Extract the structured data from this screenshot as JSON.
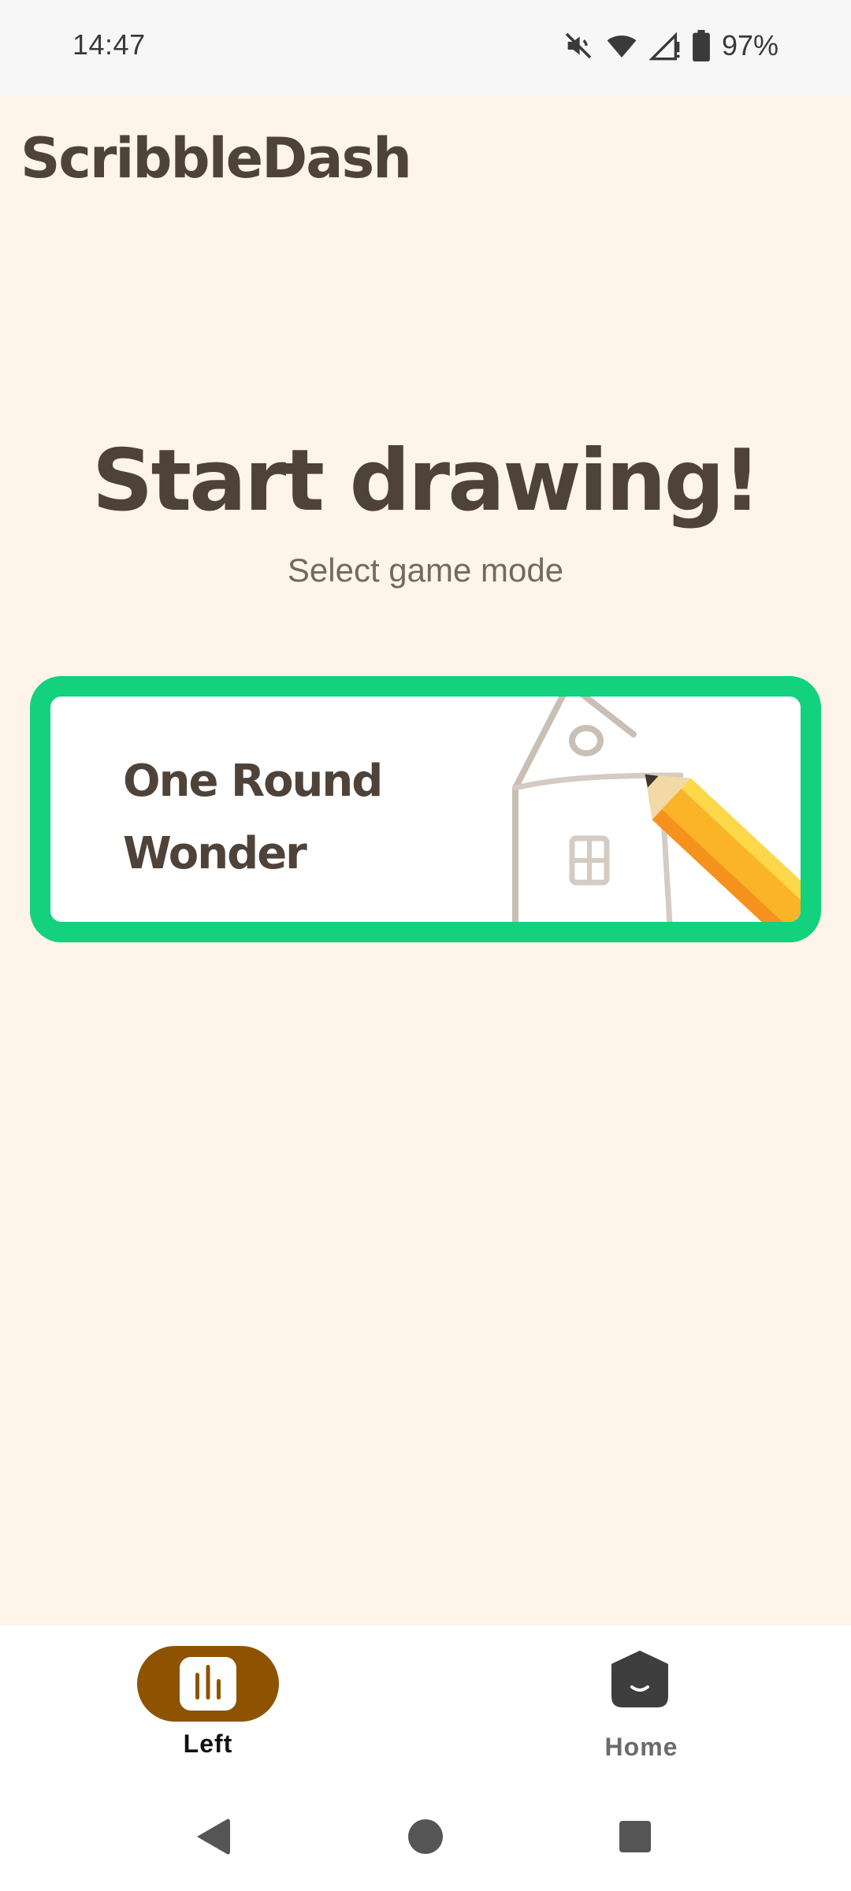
{
  "status_bar": {
    "time": "14:47",
    "battery_percent": "97%",
    "icons": [
      "mute-icon",
      "wifi-icon",
      "signal-icon",
      "battery-icon"
    ]
  },
  "app": {
    "title": "ScribbleDash"
  },
  "main": {
    "headline": "Start drawing!",
    "subheadline": "Select game mode",
    "modes": [
      {
        "label": "One Round Wonder",
        "illustration": "house-sketch-with-pencil",
        "border_color": "#13D17C"
      }
    ]
  },
  "bottom_nav": {
    "items": [
      {
        "label": "Left",
        "icon": "bar-chart-icon",
        "selected": true,
        "accent": "#8D5300"
      },
      {
        "label": "Home",
        "icon": "home-icon",
        "selected": false
      }
    ]
  },
  "system_nav": {
    "buttons": [
      "back-icon",
      "home-circle-icon",
      "recents-icon"
    ]
  },
  "colors": {
    "background": "#FEF4EA",
    "text_primary": "#4F4339",
    "text_secondary": "#74695F",
    "accent_green": "#13D17C",
    "accent_brown": "#8D5300"
  }
}
